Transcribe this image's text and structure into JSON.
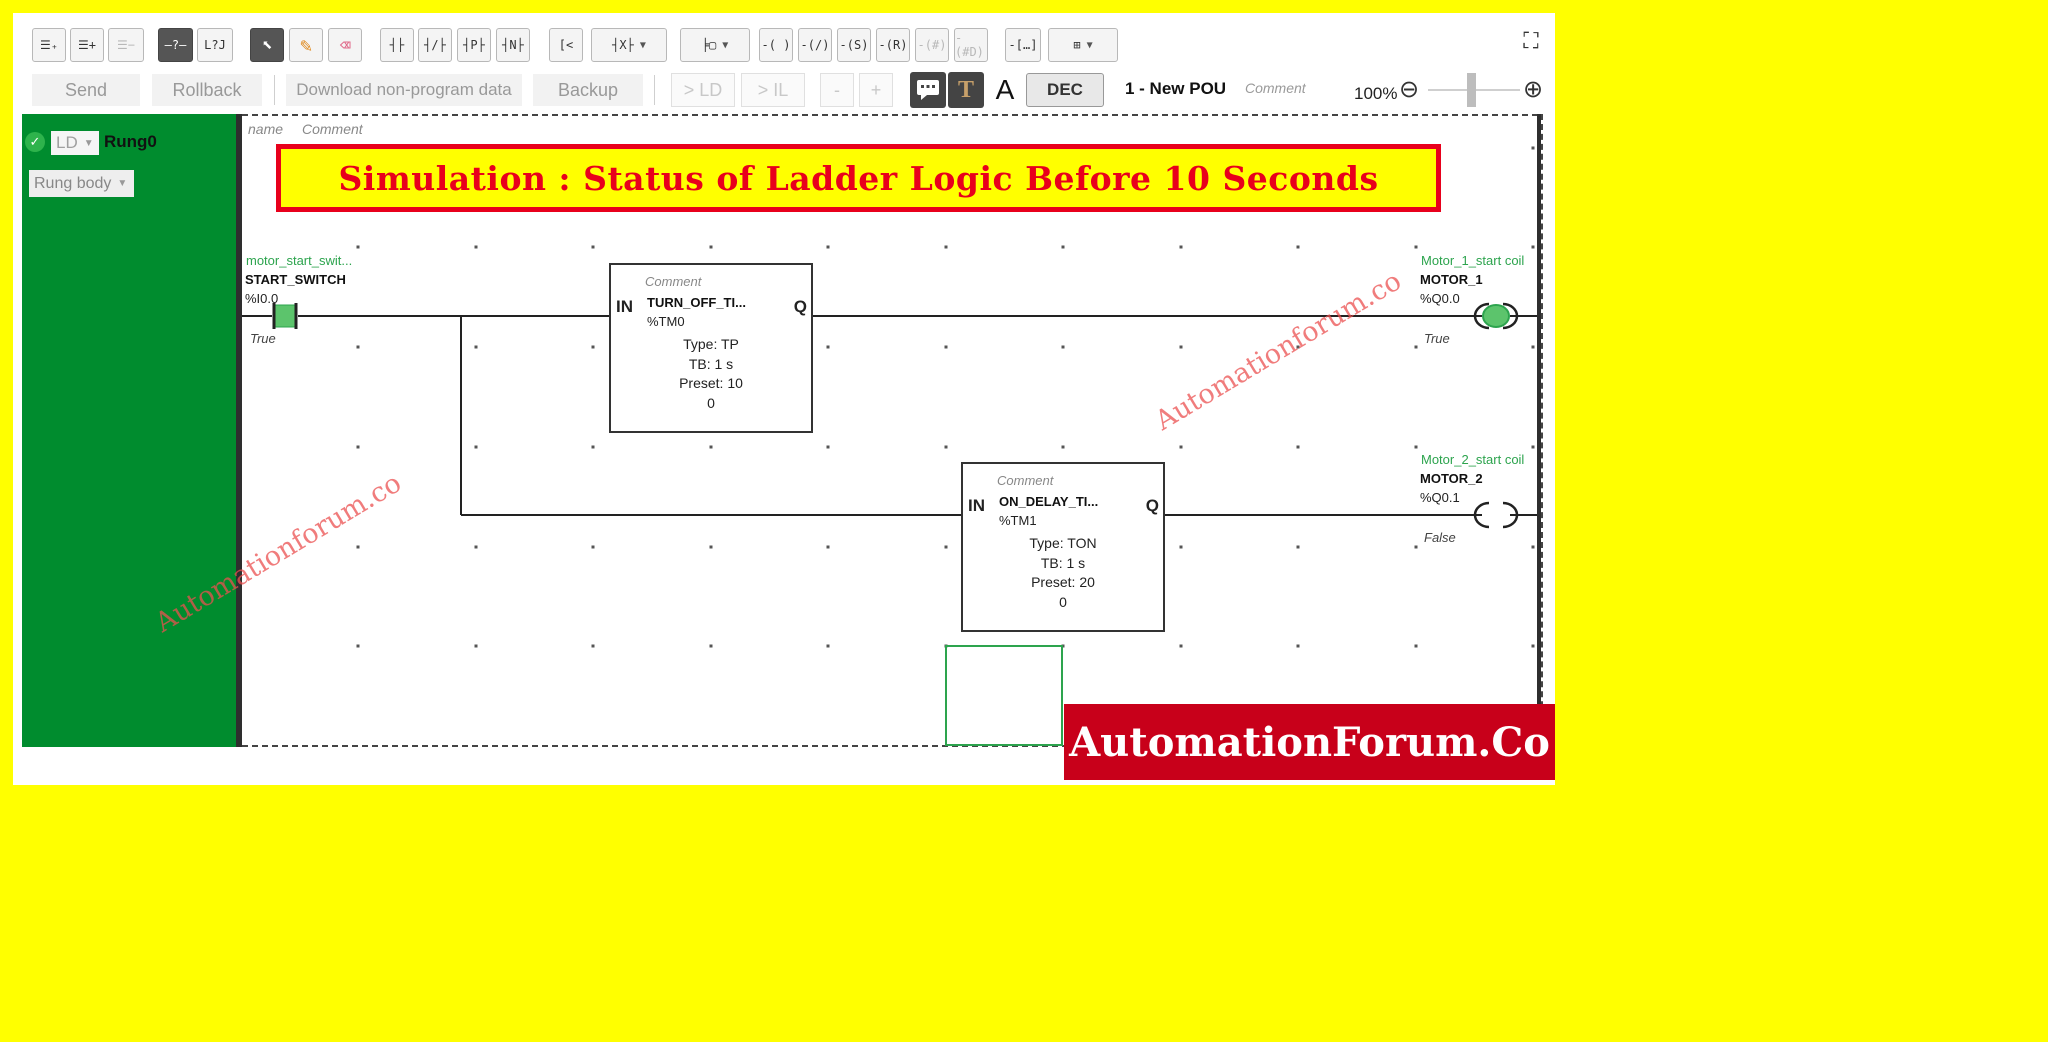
{
  "toolbar_row1": {
    "buttons": [
      {
        "glyph": "☰₊",
        "name": "insert-rung-below-button"
      },
      {
        "glyph": "☰+",
        "name": "insert-rung-above-button"
      },
      {
        "glyph": "☰−",
        "name": "delete-rung-button"
      },
      {
        "glyph": "–?–",
        "name": "unknown-element-button"
      },
      {
        "glyph": "L?J",
        "name": "branch-element-button"
      },
      {
        "glyph": "⬉",
        "name": "select-tool-button"
      },
      {
        "glyph": "✎",
        "name": "draw-tool-button"
      },
      {
        "glyph": "⌫",
        "name": "erase-tool-button"
      },
      {
        "glyph": "┤├",
        "name": "no-contact-button"
      },
      {
        "glyph": "┤/├",
        "name": "nc-contact-button"
      },
      {
        "glyph": "┤P├",
        "name": "positive-edge-contact-button"
      },
      {
        "glyph": "┤N├",
        "name": "negative-edge-contact-button"
      },
      {
        "glyph": "[<",
        "name": "compare-block-button"
      },
      {
        "glyph": "┤X├",
        "name": "xor-block-button"
      },
      {
        "glyph": "╞▢",
        "name": "function-block-button"
      },
      {
        "glyph": "-( )",
        "name": "coil-button"
      },
      {
        "glyph": "-(/)",
        "name": "negated-coil-button"
      },
      {
        "glyph": "-(S)",
        "name": "set-coil-button"
      },
      {
        "glyph": "-(R)",
        "name": "reset-coil-button"
      },
      {
        "glyph": "-(#)",
        "name": "jump-coil-button"
      },
      {
        "glyph": "-(#D)",
        "name": "jump-d-coil-button"
      },
      {
        "glyph": "-[…]",
        "name": "operation-block-button"
      },
      {
        "glyph": "⊞",
        "name": "add-block-button"
      }
    ],
    "fullscreen_glyph": "⛶"
  },
  "toolbar_row2": {
    "send": "Send",
    "rollback": "Rollback",
    "download": "Download non-program data",
    "backup": "Backup",
    "to_ld": "> LD",
    "to_il": "> IL",
    "minus": "-",
    "plus": "+",
    "dec": "DEC",
    "pou": "1 - New POU",
    "pou_comment": "Comment",
    "zoom": "100%",
    "zoom_out": "⊖",
    "zoom_in": "⊕"
  },
  "rung_panel": {
    "lang": "LD",
    "rung_name": "Rung0",
    "rung_body": "Rung body"
  },
  "canvas": {
    "name_label": "name",
    "comment_label": "Comment",
    "banner": "Simulation : Status of Ladder Logic Before 10 Seconds"
  },
  "contact": {
    "comment": "motor_start_swit...",
    "symbol": "START_SWITCH",
    "address": "%I0.0",
    "state": "True"
  },
  "timer_tp": {
    "comment": "Comment",
    "in": "IN",
    "q": "Q",
    "name": "TURN_OFF_TI...",
    "address": "%TM0",
    "type": "Type: TP",
    "tb": "TB: 1 s",
    "preset": "Preset: 10",
    "value": "0"
  },
  "timer_ton": {
    "comment": "Comment",
    "in": "IN",
    "q": "Q",
    "name": "ON_DELAY_TI...",
    "address": "%TM1",
    "type": "Type: TON",
    "tb": "TB: 1 s",
    "preset": "Preset: 20",
    "value": "0"
  },
  "coil1": {
    "comment": "Motor_1_start coil",
    "symbol": "MOTOR_1",
    "address": "%Q0.0",
    "state": "True"
  },
  "coil2": {
    "comment": "Motor_2_start coil",
    "symbol": "MOTOR_2",
    "address": "%Q0.1",
    "state": "False"
  },
  "watermark": "Automationforum.co",
  "logo": "AutomationForum.Co",
  "colors": {
    "frame": "#ffff00",
    "rung_panel": "#008c2e",
    "energized": "#2da44e",
    "banner_border": "#e8001c",
    "logo_bg": "#c8001a"
  }
}
